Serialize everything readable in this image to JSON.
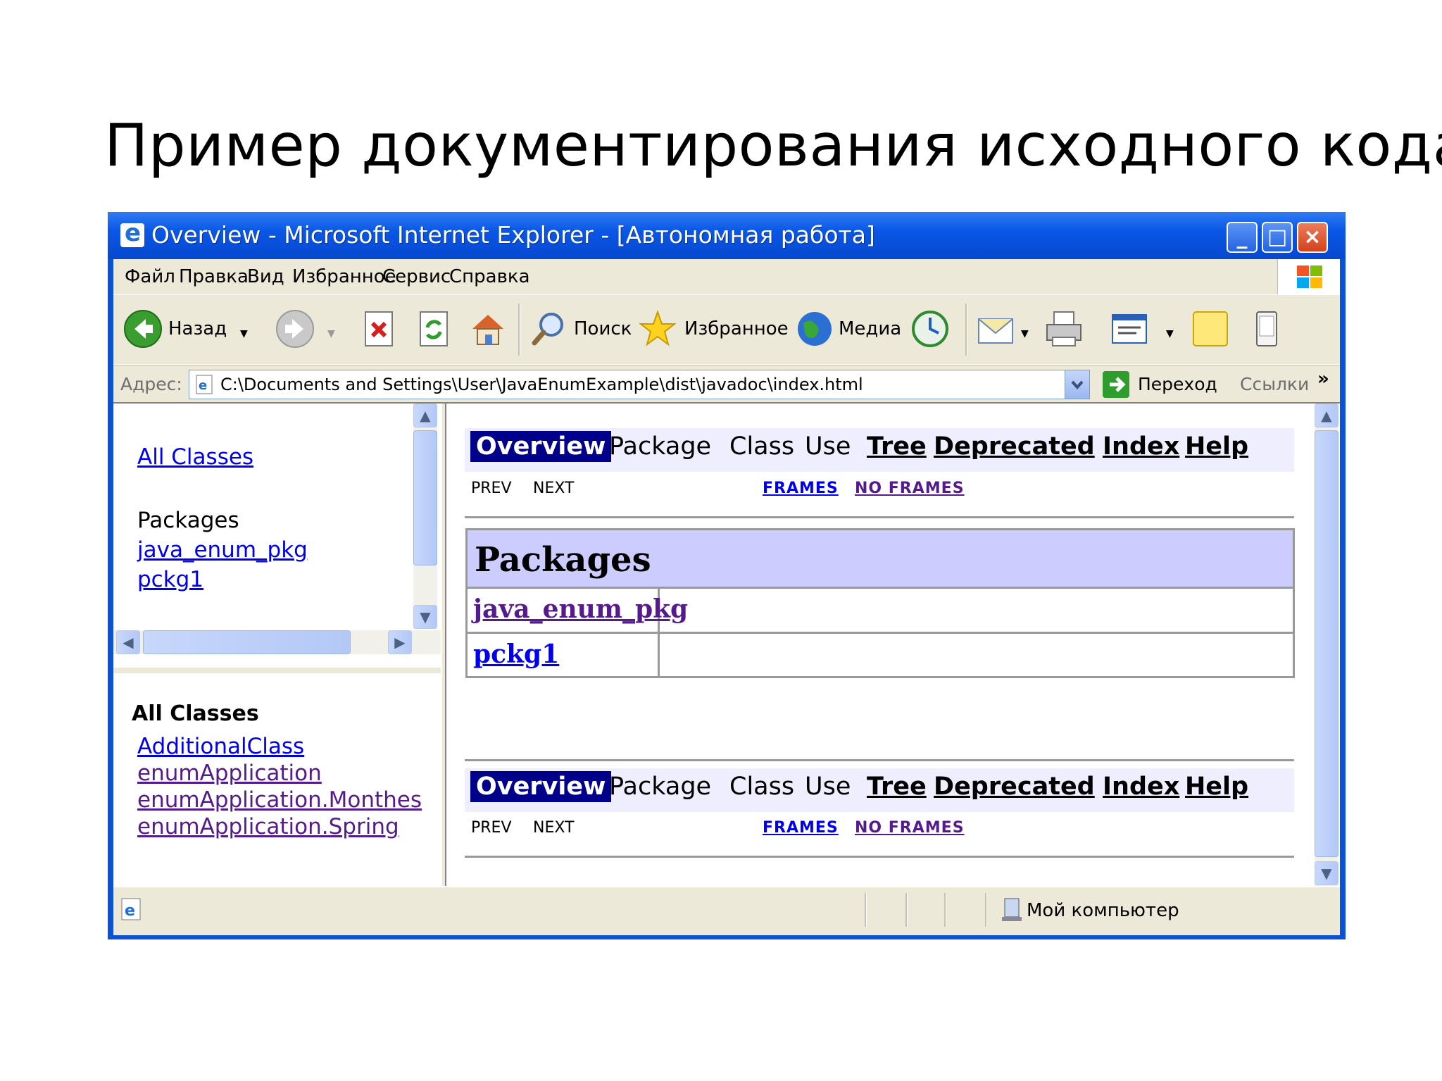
{
  "slide": {
    "title": "Пример документирования исходного кода I"
  },
  "window": {
    "title": "Overview - Microsoft Internet Explorer - [Автономная работа]"
  },
  "menu": [
    "Файл",
    "Правка",
    "Вид",
    "Избранное",
    "Сервис",
    "Справка"
  ],
  "toolbar": {
    "back": "Назад",
    "search": "Поиск",
    "favorites": "Избранное",
    "media": "Медиа"
  },
  "address": {
    "label": "Адрес:",
    "value": "C:\\Documents and Settings\\User\\JavaEnumExample\\dist\\javadoc\\index.html",
    "go": "Переход",
    "links": "Ссылки",
    "chevron": "»"
  },
  "left_top": {
    "all_classes": "All Classes",
    "packages_heading": "Packages",
    "packages": [
      "java_enum_pkg",
      "pckg1"
    ]
  },
  "left_bottom": {
    "heading": "All Classes",
    "classes": [
      "AdditionalClass",
      "enumApplication",
      "enumApplication.Monthes",
      "enumApplication.Spring"
    ]
  },
  "nav": {
    "overview": "Overview",
    "package": "Package",
    "class": "Class",
    "use": "Use",
    "tree": "Tree",
    "deprecated": "Deprecated",
    "index": "Index",
    "help": "Help",
    "prev": "PREV",
    "next": "NEXT",
    "frames": "FRAMES",
    "no_frames": "NO FRAMES"
  },
  "packages_table": {
    "heading": "Packages",
    "rows": [
      "java_enum_pkg",
      "pckg1"
    ]
  },
  "status": {
    "zone": "Мой компьютер"
  },
  "colors": {
    "titlebar": "#0a57e6",
    "nav_active": "#00008b",
    "nav_bg": "#eeeeff",
    "table_head": "#ccccff",
    "link": "#0000ee",
    "visited": "#551a8b"
  }
}
